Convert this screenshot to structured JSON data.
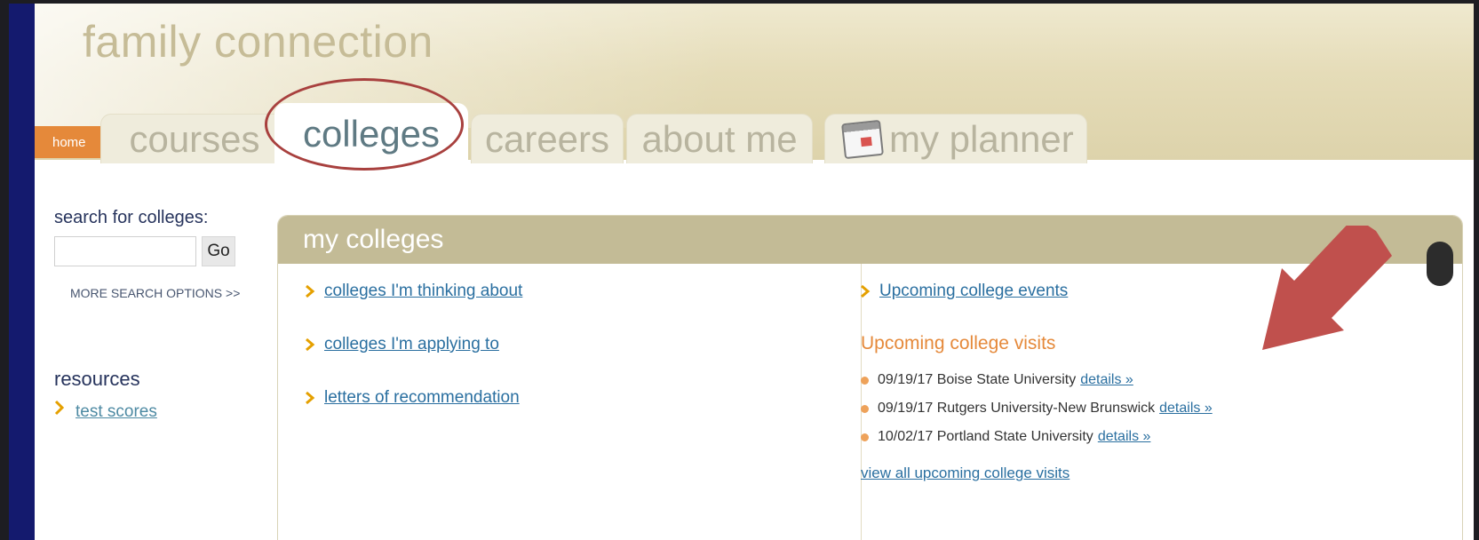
{
  "header": {
    "brand": "family connection"
  },
  "nav": {
    "home_label": "home",
    "tabs": [
      {
        "label": "courses"
      },
      {
        "label": "colleges"
      },
      {
        "label": "careers"
      },
      {
        "label": "about me"
      },
      {
        "label": "my planner",
        "icon": "calendar-icon"
      }
    ],
    "active_tab": "colleges"
  },
  "search": {
    "label": "search for colleges:",
    "value": "",
    "placeholder": "",
    "go_label": "Go",
    "more_options": "MORE SEARCH OPTIONS >>"
  },
  "resources": {
    "heading": "resources",
    "items": [
      {
        "label": "test scores"
      }
    ]
  },
  "panel": {
    "title": "my colleges",
    "left_links": [
      {
        "label": "colleges I'm thinking about"
      },
      {
        "label": "colleges I'm applying to"
      },
      {
        "label": "letters of recommendation"
      }
    ],
    "events_link": "Upcoming college events",
    "visits_heading": "Upcoming college visits",
    "visits": [
      {
        "text": "09/19/17 Boise State University",
        "details": "details »"
      },
      {
        "text": "09/19/17 Rutgers University-New Brunswick",
        "details": "details »"
      },
      {
        "text": "10/02/17 Portland State University",
        "details": "details »"
      }
    ],
    "view_all": "view all upcoming college visits"
  },
  "colors": {
    "header_bg": "#e5dcb8",
    "panel_header": "#c3bb96",
    "accent_orange": "#e5893a",
    "link_blue": "#2a6fa0",
    "annotation_red": "#c0504d",
    "sidebar_navy": "#141a6e"
  }
}
